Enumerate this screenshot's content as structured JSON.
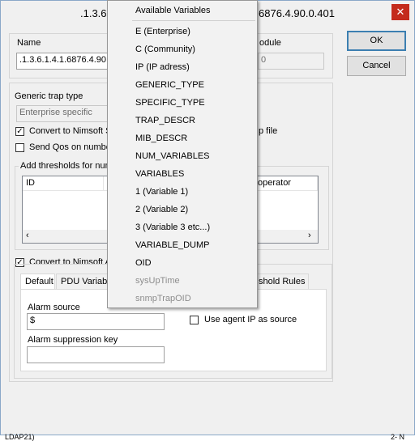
{
  "window": {
    "title_left": ".1.3.6",
    "title_right": "6876.4.90.0.401",
    "close_glyph": "✕"
  },
  "name_section": {
    "label": "Name",
    "value": ".1.3.6.1.4.1.6876.4.90.",
    "module_label": "odule",
    "module_value": "0"
  },
  "buttons": {
    "ok": "OK",
    "cancel": "Cancel"
  },
  "trap": {
    "type_label": "Generic trap type",
    "type_value": "Enterprise specific",
    "convert_label": "Convert to Nimsoft S",
    "convert_suffix": "p file",
    "qos_label": "Send Qos on numbe",
    "thresholds_legend": "Add thresholds for num",
    "columns": [
      "ID",
      "S",
      "operator"
    ]
  },
  "alarm": {
    "convert_label": "Convert to Nimsoft A",
    "tabs": [
      "Default",
      "PDU Variab",
      "shold Rules"
    ],
    "source_label": "Alarm source",
    "source_value": "$",
    "agent_ip_label": "Use agent IP as source",
    "suppression_label": "Alarm suppression key",
    "suppression_value": ""
  },
  "popup": {
    "header": "Available Variables",
    "items": [
      {
        "label": "E (Enterprise)",
        "enabled": true
      },
      {
        "label": "C (Community)",
        "enabled": true
      },
      {
        "label": "IP (IP adress)",
        "enabled": true
      },
      {
        "label": "GENERIC_TYPE",
        "enabled": true
      },
      {
        "label": "SPECIFIC_TYPE",
        "enabled": true
      },
      {
        "label": "TRAP_DESCR",
        "enabled": true
      },
      {
        "label": "MIB_DESCR",
        "enabled": true
      },
      {
        "label": "NUM_VARIABLES",
        "enabled": true
      },
      {
        "label": "VARIABLES",
        "enabled": true
      },
      {
        "label": "1 (Variable 1)",
        "enabled": true
      },
      {
        "label": "2 (Variable 2)",
        "enabled": true
      },
      {
        "label": "3 (Variable 3 etc...)",
        "enabled": true
      },
      {
        "label": "VARIABLE_DUMP",
        "enabled": true
      },
      {
        "label": "OID",
        "enabled": true
      },
      {
        "label": "sysUpTime",
        "enabled": false
      },
      {
        "label": "snmpTrapOID",
        "enabled": false
      }
    ]
  },
  "statusbar": {
    "left": "LDAP21)",
    "right": "2- N"
  }
}
